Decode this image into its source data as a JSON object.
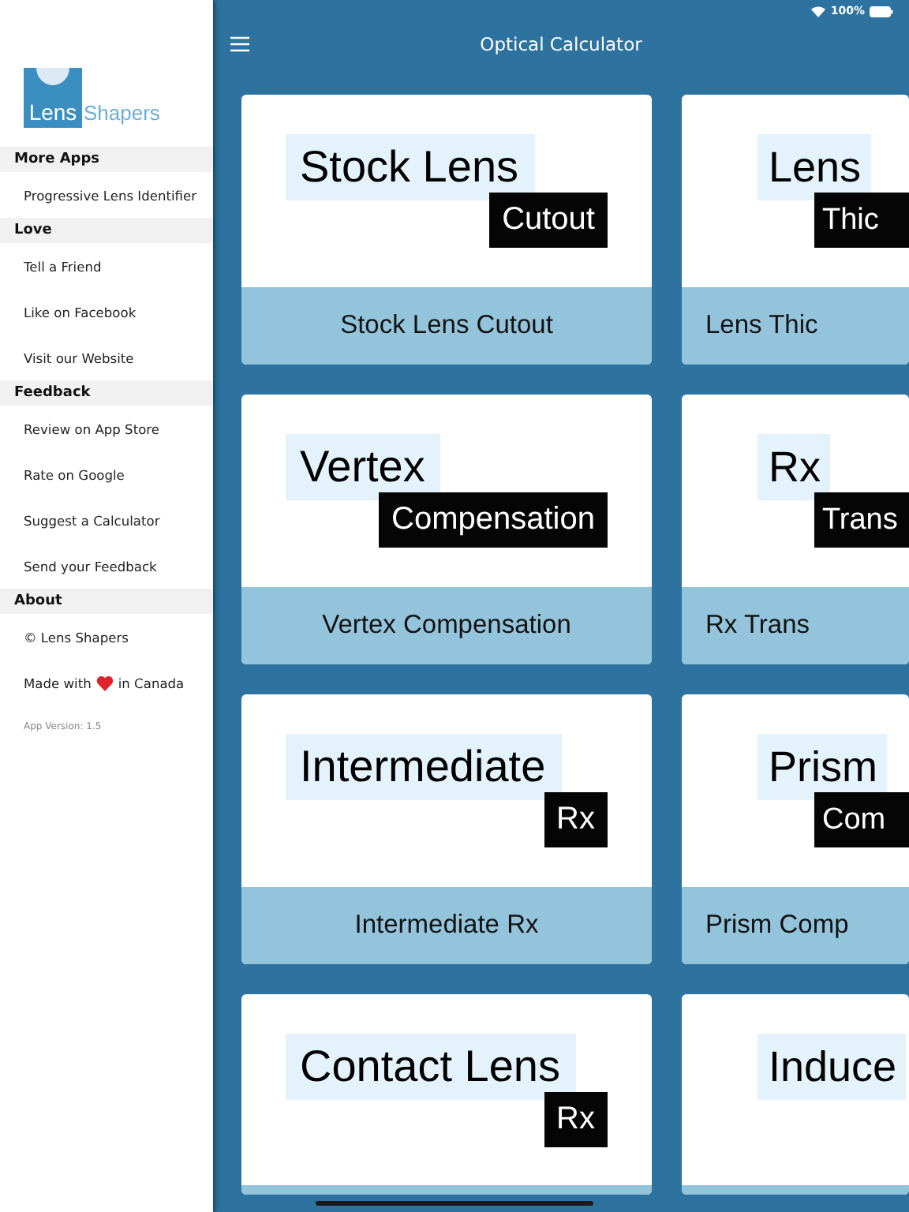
{
  "status_bar": {
    "battery": "100%"
  },
  "header": {
    "title": "Optical Calculator"
  },
  "sidebar": {
    "logo": {
      "mark_text": "Lens",
      "word": "Shapers"
    },
    "sections": [
      {
        "title": "More Apps",
        "items": [
          {
            "kind": "text",
            "label": "Progressive Lens Identifier"
          }
        ]
      },
      {
        "title": "Love",
        "items": [
          {
            "kind": "text",
            "label": "Tell a Friend"
          },
          {
            "kind": "text",
            "label": "Like on Facebook"
          },
          {
            "kind": "text",
            "label": "Visit our Website"
          }
        ]
      },
      {
        "title": "Feedback",
        "items": [
          {
            "kind": "text",
            "label": "Review on App Store"
          },
          {
            "kind": "text",
            "label": "Rate on Google"
          },
          {
            "kind": "text",
            "label": "Suggest a Calculator"
          },
          {
            "kind": "text",
            "label": "Send your Feedback"
          }
        ]
      },
      {
        "title": "About",
        "items": [
          {
            "kind": "text",
            "label": "© Lens Shapers"
          },
          {
            "kind": "heart",
            "before": "Made with",
            "after": "in Canada"
          }
        ]
      }
    ],
    "version": "App Version: 1.5"
  },
  "cards": [
    {
      "title": "Stock Lens",
      "subtitle": "Cutout",
      "label": "Stock Lens Cutout"
    },
    {
      "title": "Lens",
      "subtitle": "Thic",
      "label": "Lens Thic"
    },
    {
      "title": "Vertex",
      "subtitle": "Compensation",
      "label": "Vertex Compensation"
    },
    {
      "title": "Rx",
      "subtitle": "Trans",
      "label": "Rx Trans"
    },
    {
      "title": "Intermediate",
      "subtitle": "Rx",
      "label": "Intermediate Rx"
    },
    {
      "title": "Prism",
      "subtitle": "Com",
      "label": "Prism Comp"
    },
    {
      "title": "Contact Lens",
      "subtitle": "Rx"
    },
    {
      "title": "Induce"
    }
  ]
}
